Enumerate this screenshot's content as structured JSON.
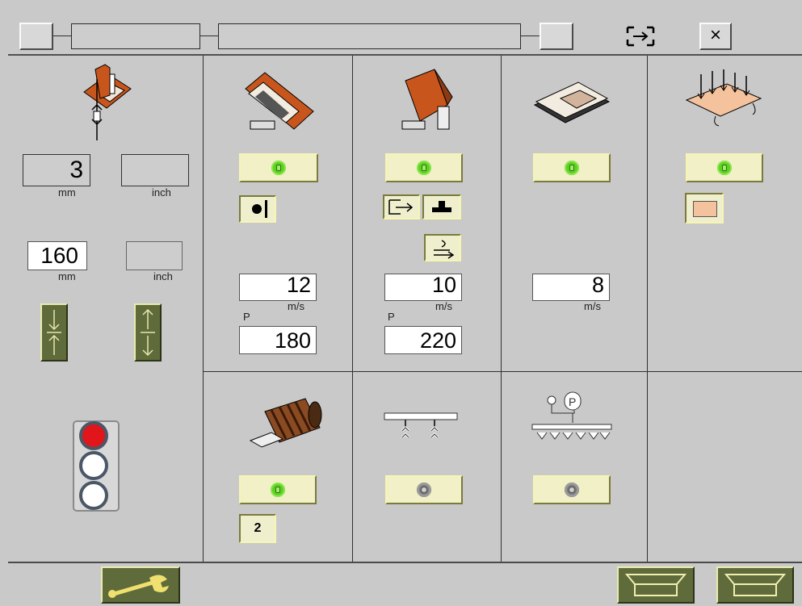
{
  "window": {
    "title_field_left": "",
    "title_field_right": "",
    "transfer_icon": "transfer-arrows-icon",
    "close_label": "×"
  },
  "left_panel": {
    "thickness_mm": "3",
    "thickness_mm_unit": "mm",
    "thickness_inch": "",
    "thickness_inch_unit": "inch",
    "width_mm": "160",
    "width_mm_unit": "mm",
    "width_inch": "",
    "width_inch_unit": "inch"
  },
  "stations": {
    "belt1": {
      "speed": "12",
      "speed_unit": "m/s",
      "pressure_prefix": "P",
      "pressure": "180"
    },
    "belt2": {
      "speed": "10",
      "speed_unit": "m/s",
      "pressure_prefix": "P",
      "pressure": "220"
    },
    "belt3": {
      "speed": "8",
      "speed_unit": "m/s"
    }
  },
  "brush": {
    "count": "2"
  },
  "colors": {
    "background": "#c9c9c9",
    "button_yellow": "#f1f0c6",
    "indicator_green": "#5fcf22",
    "indicator_off": "#777777",
    "tool_orange": "#c8561c",
    "traffic_red": "#e0161a",
    "swatch": "#f4c29c"
  }
}
